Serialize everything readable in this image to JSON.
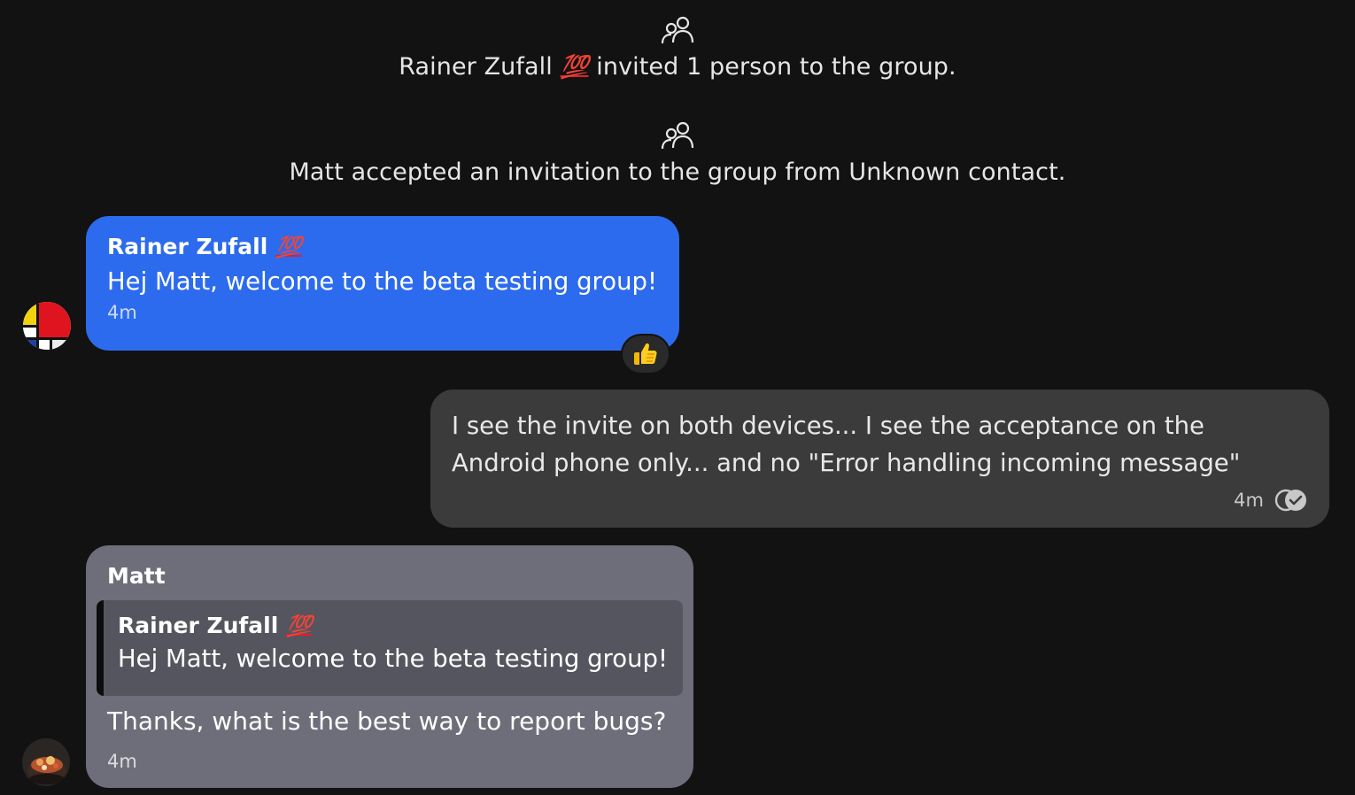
{
  "notices": [
    {
      "icon": "group-icon",
      "actor": "Rainer Zufall",
      "actor_badge": "💯",
      "text": "invited 1 person to the group."
    },
    {
      "icon": "group-icon",
      "text": "Matt accepted an invitation to the group from Unknown contact."
    }
  ],
  "messages": [
    {
      "author": "Rainer Zufall",
      "author_badge": "💯",
      "body": "Hej Matt, welcome to the beta testing group!",
      "time": "4m",
      "reaction": "👍",
      "color": "#2c6bed"
    },
    {
      "body_line_1": "I see the invite on both devices... I see the acceptance on the",
      "body_line_2": "Android phone only... and no \"Error handling incoming message\"",
      "time": "4m",
      "status": "delivered",
      "color": "#3b3b3b"
    },
    {
      "author": "Matt",
      "quote": {
        "author": "Rainer Zufall",
        "author_badge": "💯",
        "body": "Hej Matt, welcome to the beta testing group!"
      },
      "body": "Thanks, what is the best way to report bugs?",
      "time": "4m",
      "color": "#6e6e7a"
    }
  ]
}
